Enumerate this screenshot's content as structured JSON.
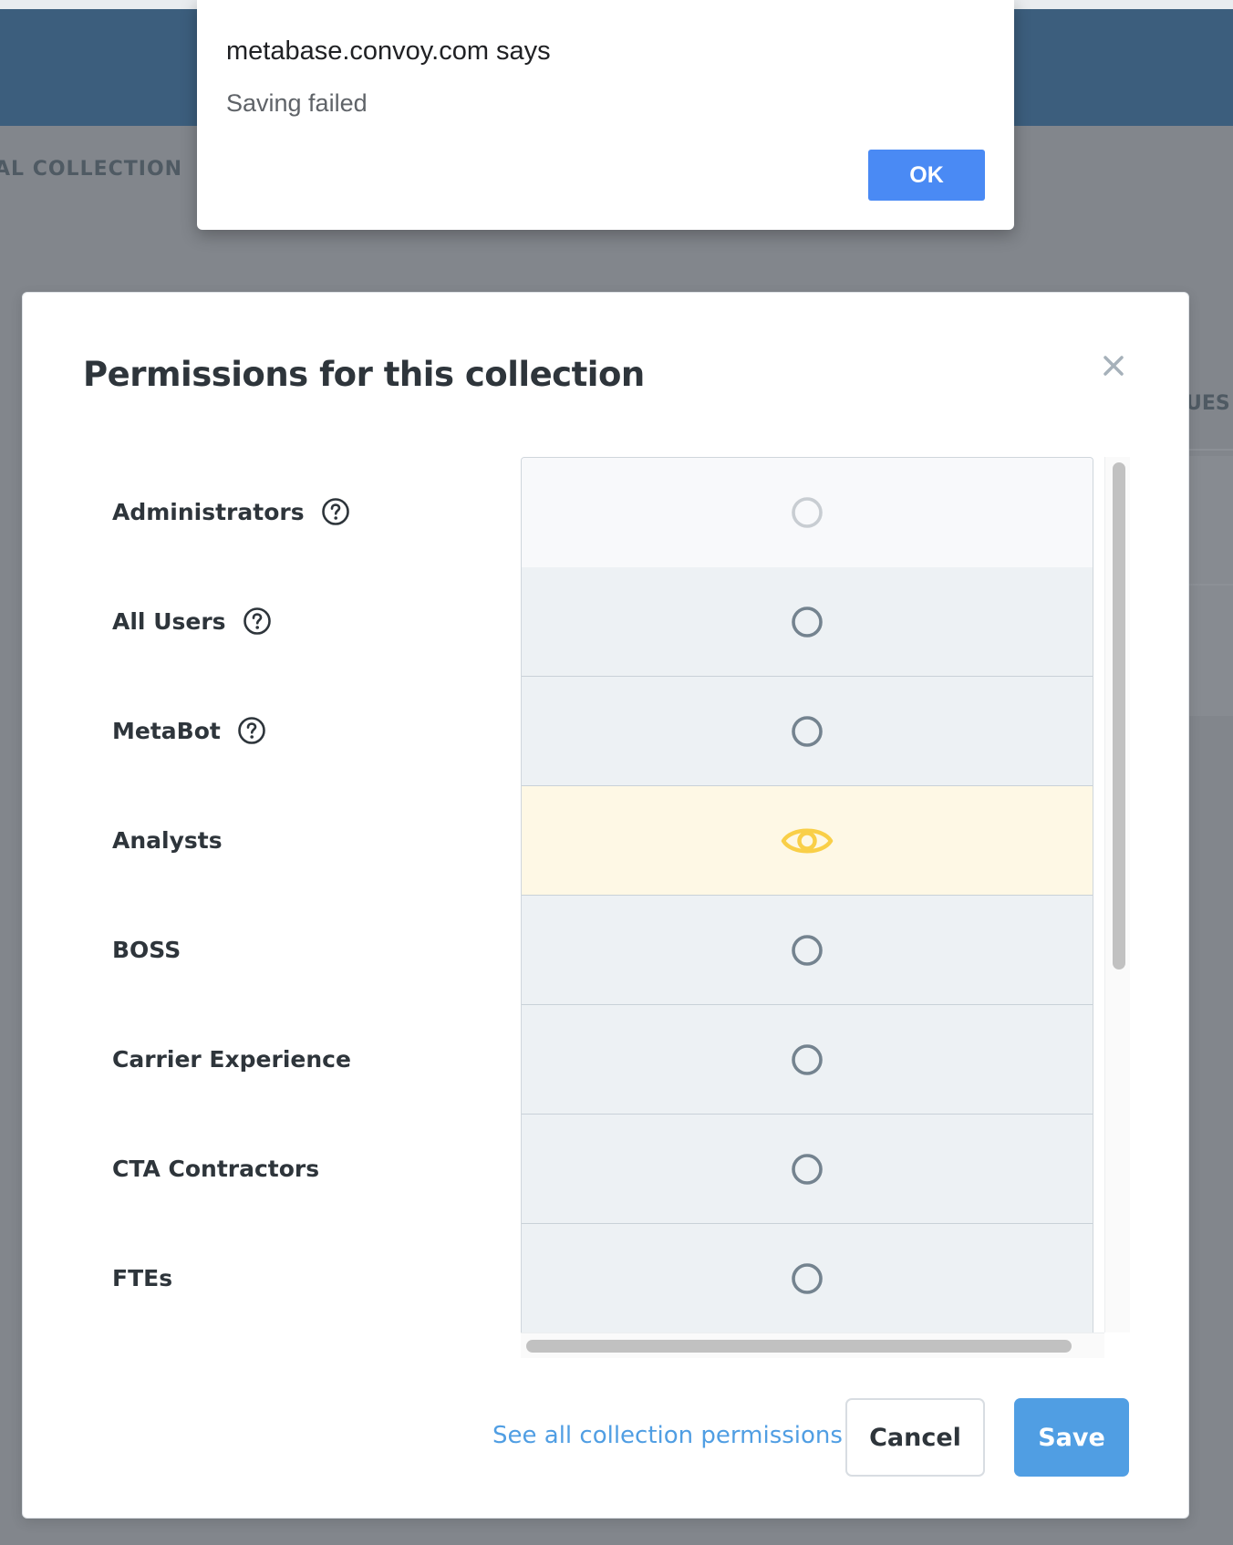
{
  "background": {
    "collection_label": "AL COLLECTION",
    "right_label": "UES"
  },
  "alert": {
    "title": "metabase.convoy.com says",
    "message": "Saving failed",
    "ok_label": "OK"
  },
  "modal": {
    "title": "Permissions for this collection",
    "close_icon": "close-icon",
    "groups": [
      {
        "label": "Administrators",
        "has_help": true,
        "access": "none-disabled"
      },
      {
        "label": "All Users",
        "has_help": true,
        "access": "none"
      },
      {
        "label": "MetaBot",
        "has_help": true,
        "access": "none"
      },
      {
        "label": "Analysts",
        "has_help": false,
        "access": "view"
      },
      {
        "label": "BOSS",
        "has_help": false,
        "access": "none"
      },
      {
        "label": "Carrier Experience",
        "has_help": false,
        "access": "none"
      },
      {
        "label": "CTA Contractors",
        "has_help": false,
        "access": "none"
      },
      {
        "label": "FTEs",
        "has_help": false,
        "access": "none"
      }
    ],
    "footer": {
      "see_all_label": "See all collection permissions",
      "cancel_label": "Cancel",
      "save_label": "Save"
    }
  },
  "colors": {
    "header": "#3c5e7d",
    "brand": "#509ee3",
    "view_access": "#f9cf48",
    "no_access": "#74838f",
    "alert_button": "#4a8af4"
  }
}
